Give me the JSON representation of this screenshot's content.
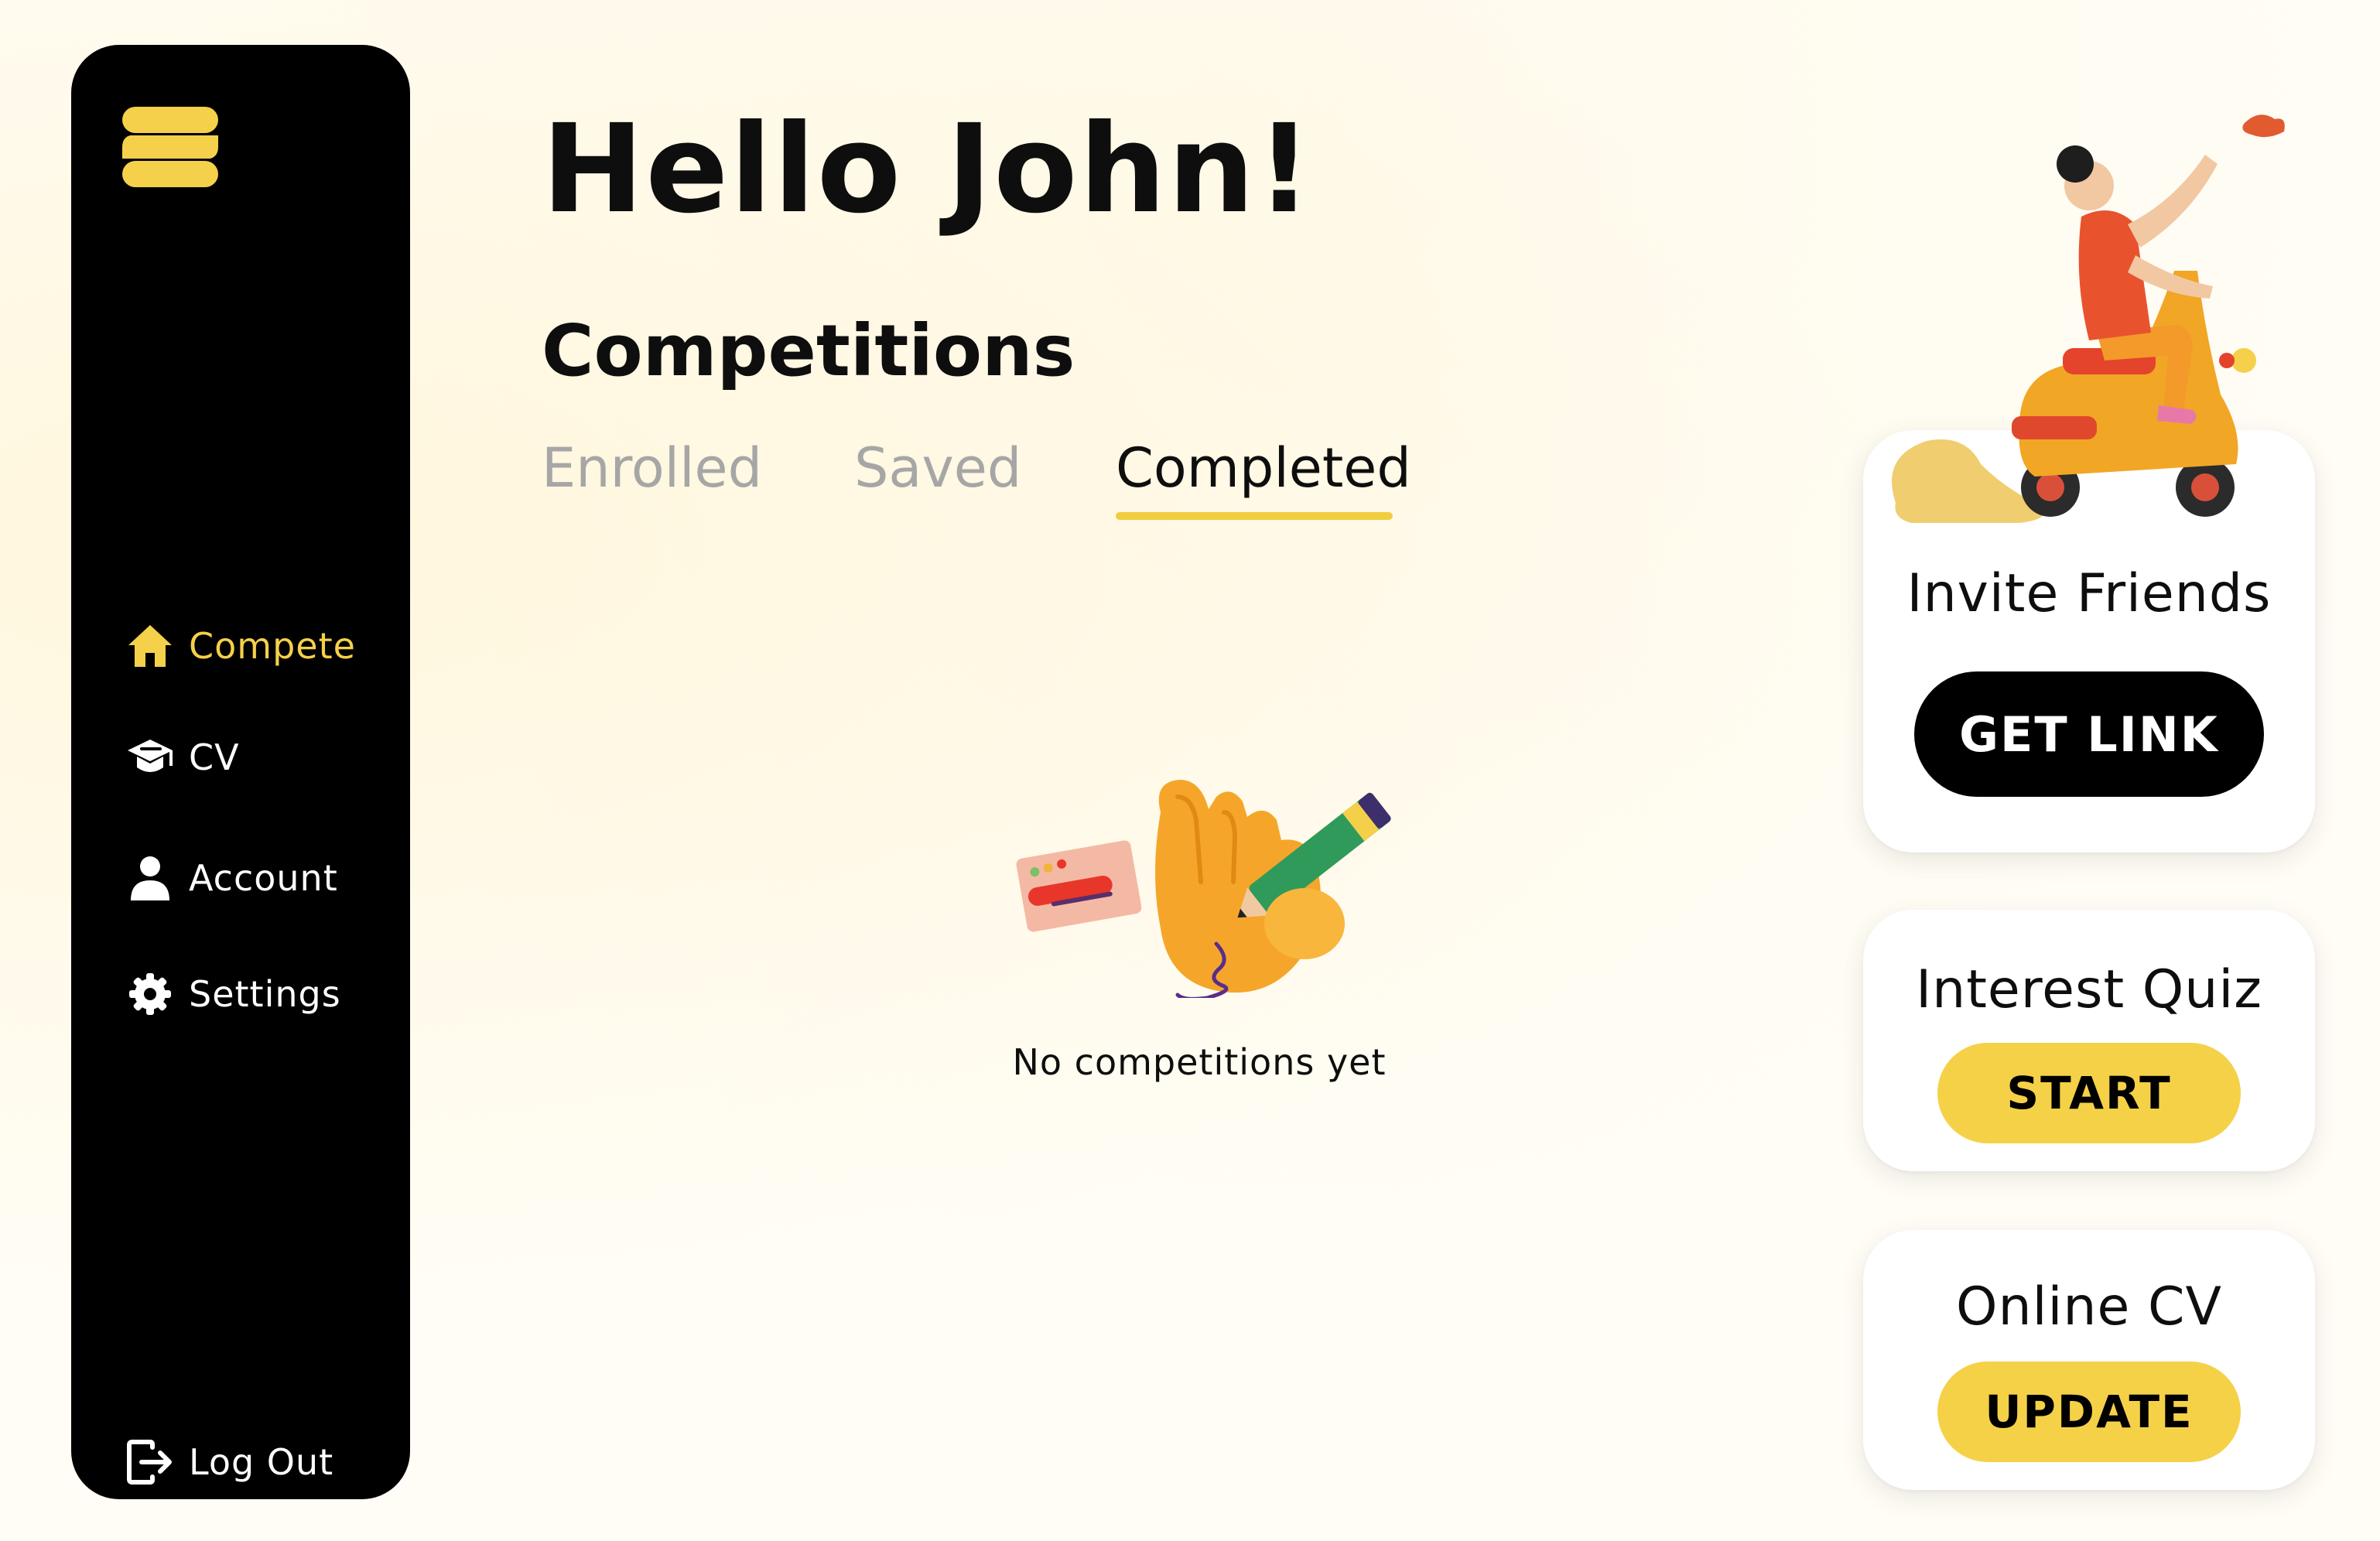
{
  "sidebar": {
    "logo_icon": "brand-s-logo",
    "items": [
      {
        "label": "Compete",
        "icon": "home-icon",
        "active": true
      },
      {
        "label": "CV",
        "icon": "graduation-cap-icon",
        "active": false
      },
      {
        "label": "Account",
        "icon": "user-icon",
        "active": false
      },
      {
        "label": "Settings",
        "icon": "gear-icon",
        "active": false
      }
    ],
    "logout": {
      "label": "Log Out",
      "icon": "logout-icon"
    }
  },
  "main": {
    "greeting": "Hello John!",
    "section_title": "Competitions",
    "tabs": [
      {
        "label": "Enrolled",
        "active": false
      },
      {
        "label": "Saved",
        "active": false
      },
      {
        "label": "Completed",
        "active": true
      }
    ],
    "empty_state": {
      "text": "No competitions yet",
      "illustration": "hand-writing-illustration"
    }
  },
  "cards": {
    "invite": {
      "title": "Invite Friends",
      "button": "GET LINK",
      "illustration": "scooter-rider-illustration"
    },
    "quiz": {
      "title": "Interest Quiz",
      "button": "START"
    },
    "cv": {
      "title": "Online CV",
      "button": "UPDATE"
    }
  },
  "colors": {
    "accent": "#f5d147",
    "sidebar_bg": "#000000",
    "muted_text": "#a6a6a6"
  }
}
